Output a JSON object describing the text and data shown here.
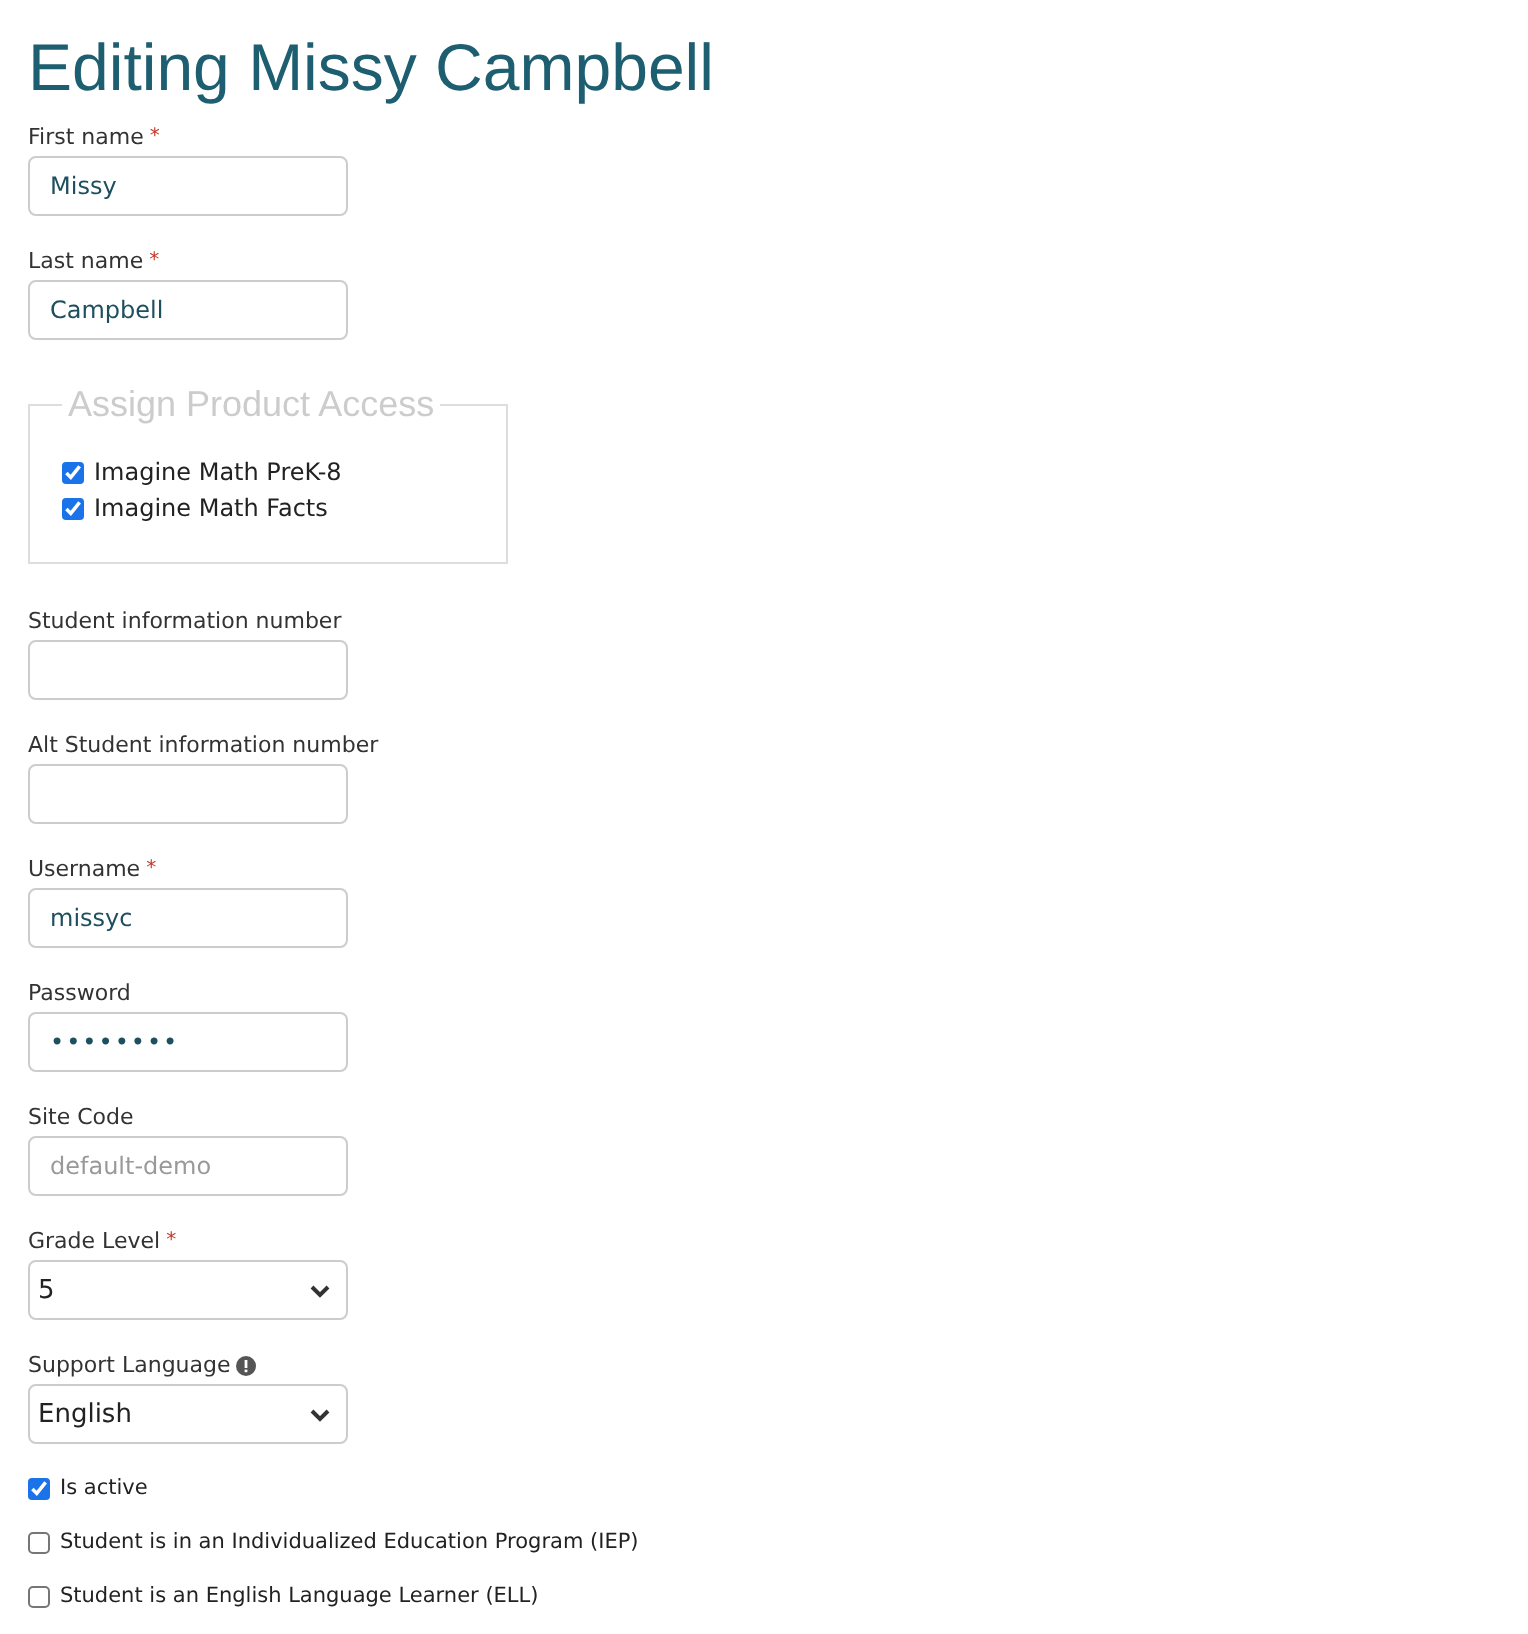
{
  "title": "Editing Missy Campbell",
  "name_fields": [
    {
      "kind": "text",
      "label": "First name",
      "required_mark": "*",
      "value": "Missy"
    },
    {
      "kind": "text",
      "label": "Last name",
      "required_mark": "*",
      "value": "Campbell"
    }
  ],
  "product_access": {
    "legend": "Assign Product Access",
    "products": [
      {
        "label": "Imagine Math PreK-8",
        "checked": true
      },
      {
        "label": "Imagine Math Facts",
        "checked": true
      }
    ]
  },
  "fields": [
    {
      "kind": "text",
      "label": "Student information number"
    },
    {
      "kind": "text",
      "label": "Alt Student information number"
    },
    {
      "kind": "text",
      "label": "Username",
      "required_mark": "*",
      "value": "missyc"
    },
    {
      "kind": "password",
      "label": "Password",
      "value": "••••••••"
    },
    {
      "kind": "text",
      "label": "Site Code",
      "placeholder": "default-demo"
    },
    {
      "kind": "select",
      "label": "Grade Level",
      "required_mark": "*",
      "value": "5"
    },
    {
      "kind": "select",
      "label": "Support Language",
      "info": true,
      "value": "English"
    }
  ],
  "options": [
    {
      "label": "Is active",
      "checked": true
    },
    {
      "label": "Student is in an Individualized Education Program (IEP)",
      "checked": false
    },
    {
      "label": "Student is an English Language Learner (ELL)",
      "checked": false
    }
  ]
}
